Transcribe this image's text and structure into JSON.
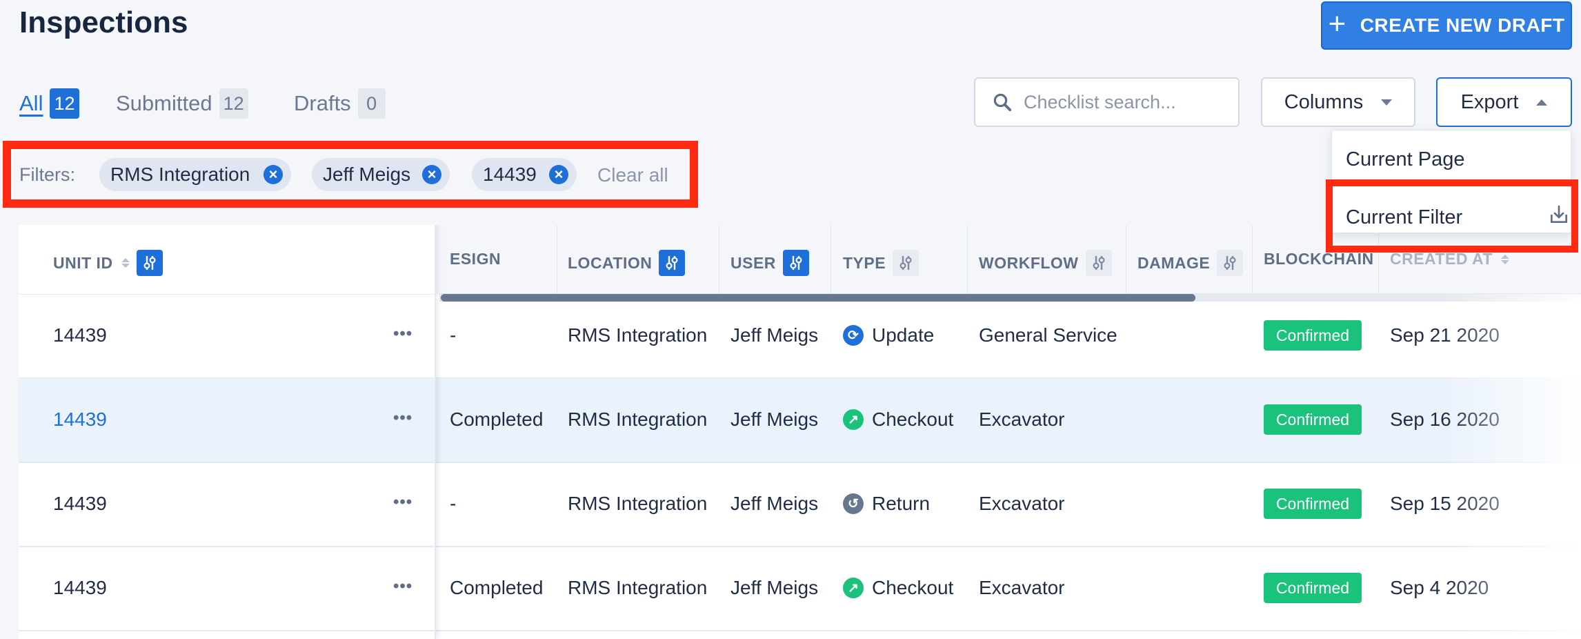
{
  "header": {
    "title": "Inspections",
    "create_button": {
      "icon": "plus-icon",
      "label": "CREATE NEW DRAFT"
    }
  },
  "tabs": [
    {
      "label": "All",
      "count": "12",
      "active": true
    },
    {
      "label": "Submitted",
      "count": "12",
      "active": false
    },
    {
      "label": "Drafts",
      "count": "0",
      "active": false
    }
  ],
  "search": {
    "placeholder": "Checklist search...",
    "value": ""
  },
  "columns_button": {
    "label": "Columns"
  },
  "export_button": {
    "label": "Export"
  },
  "export_menu": {
    "items": [
      {
        "label": "Current Page"
      },
      {
        "label": "Current Filter",
        "icon": "download-icon"
      }
    ]
  },
  "filters": {
    "label": "Filters:",
    "chips": [
      "RMS Integration",
      "Jeff Meigs",
      "14439"
    ],
    "clear_all": "Clear all"
  },
  "table": {
    "columns": [
      {
        "key": "unit_id",
        "label": "UNIT ID",
        "sortable": true,
        "filter_active": true
      },
      {
        "key": "esign",
        "label": "ESIGN"
      },
      {
        "key": "location",
        "label": "LOCATION",
        "filter_active": true
      },
      {
        "key": "user",
        "label": "USER",
        "filter_active": true
      },
      {
        "key": "type",
        "label": "TYPE",
        "filter_active": false
      },
      {
        "key": "workflow",
        "label": "WORKFLOW",
        "filter_active": false
      },
      {
        "key": "damage",
        "label": "DAMAGE",
        "filter_active": false
      },
      {
        "key": "blockchain",
        "label": "BLOCKCHAIN"
      },
      {
        "key": "created_at",
        "label": "CREATED AT",
        "sortable": true,
        "filter_active": false
      }
    ],
    "rows": [
      {
        "unit_id": "14439",
        "esign": "-",
        "location": "RMS Integration",
        "user": "Jeff Meigs",
        "type": "Update",
        "type_icon": "refresh-icon",
        "workflow": "General Service",
        "damage": "",
        "blockchain": "Confirmed",
        "created_at": "Sep 21 2020",
        "selected": false
      },
      {
        "unit_id": "14439",
        "esign": "Completed",
        "location": "RMS Integration",
        "user": "Jeff Meigs",
        "type": "Checkout",
        "type_icon": "arrow-up-right-icon",
        "workflow": "Excavator",
        "damage": "",
        "blockchain": "Confirmed",
        "created_at": "Sep 16 2020",
        "selected": true
      },
      {
        "unit_id": "14439",
        "esign": "-",
        "location": "RMS Integration",
        "user": "Jeff Meigs",
        "type": "Return",
        "type_icon": "return-icon",
        "workflow": "Excavator",
        "damage": "",
        "blockchain": "Confirmed",
        "created_at": "Sep 15 2020",
        "selected": false
      },
      {
        "unit_id": "14439",
        "esign": "Completed",
        "location": "RMS Integration",
        "user": "Jeff Meigs",
        "type": "Checkout",
        "type_icon": "arrow-up-right-icon",
        "workflow": "Excavator",
        "damage": "",
        "blockchain": "Confirmed",
        "created_at": "Sep 4 2020",
        "selected": false
      }
    ]
  },
  "colors": {
    "primary": "#1e6fd9",
    "highlight": "#ff2a12",
    "confirmed": "#1bc27b",
    "update_icon": "#1e6fd9",
    "checkout_icon": "#1bc27b",
    "return_icon": "#66778f"
  }
}
